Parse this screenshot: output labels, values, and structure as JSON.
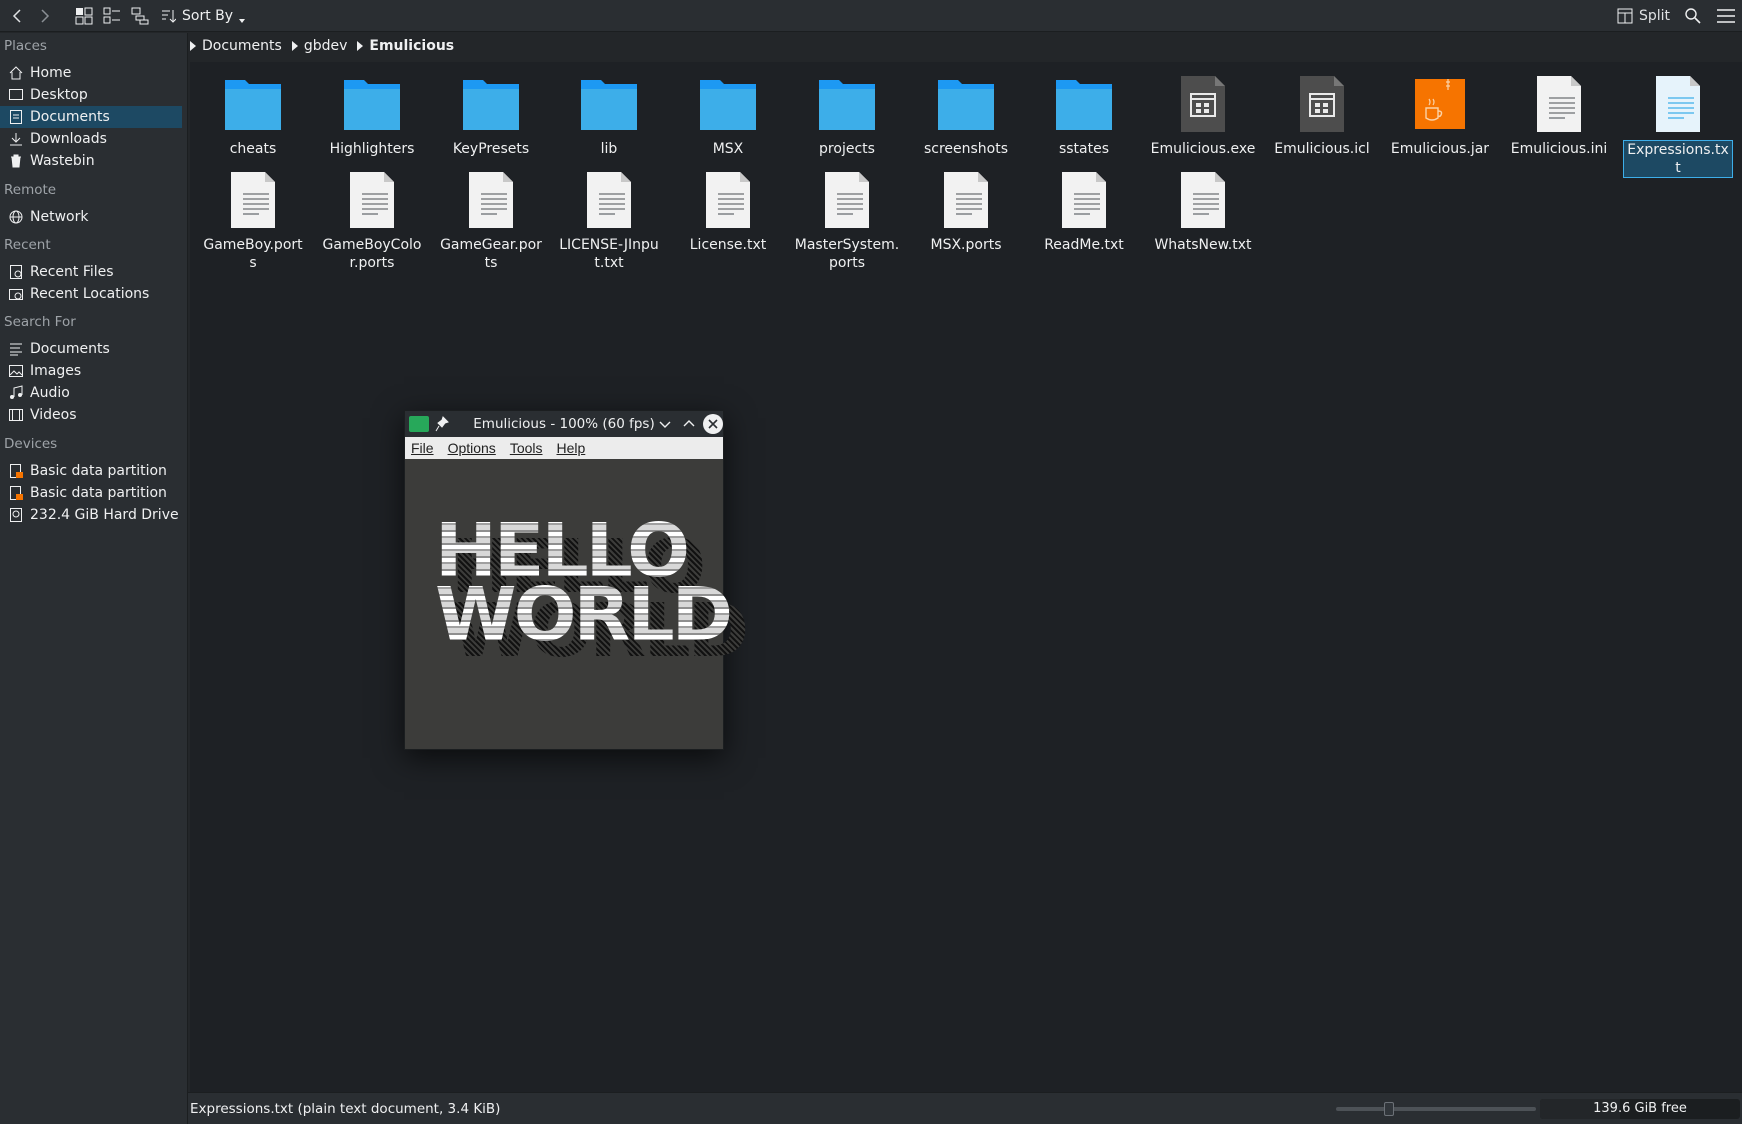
{
  "toolbar": {
    "sort_label": "Sort By",
    "split_label": "Split"
  },
  "sidebar": {
    "sections": {
      "places": "Places",
      "remote": "Remote",
      "recent": "Recent",
      "search_for": "Search For",
      "devices": "Devices"
    },
    "places": [
      {
        "label": "Home",
        "icon": "home-icon"
      },
      {
        "label": "Desktop",
        "icon": "desktop-icon"
      },
      {
        "label": "Documents",
        "icon": "documents-icon",
        "active": true
      },
      {
        "label": "Downloads",
        "icon": "downloads-icon"
      },
      {
        "label": "Wastebin",
        "icon": "trash-icon"
      }
    ],
    "remote": [
      {
        "label": "Network",
        "icon": "network-icon"
      }
    ],
    "recent": [
      {
        "label": "Recent Files",
        "icon": "recent-files-icon"
      },
      {
        "label": "Recent Locations",
        "icon": "recent-locations-icon"
      }
    ],
    "search_for": [
      {
        "label": "Documents",
        "icon": "documents-search-icon"
      },
      {
        "label": "Images",
        "icon": "images-icon"
      },
      {
        "label": "Audio",
        "icon": "audio-icon"
      },
      {
        "label": "Videos",
        "icon": "videos-icon"
      }
    ],
    "devices": [
      {
        "label": "Basic data partition",
        "icon": "partition-icon"
      },
      {
        "label": "Basic data partition",
        "icon": "partition-icon"
      },
      {
        "label": "232.4 GiB Hard Drive",
        "icon": "hard-drive-icon"
      }
    ]
  },
  "breadcrumb": [
    "Documents",
    "gbdev",
    "Emulicious"
  ],
  "files": [
    {
      "name": "cheats",
      "type": "folder"
    },
    {
      "name": "Highlighters",
      "type": "folder"
    },
    {
      "name": "KeyPresets",
      "type": "folder"
    },
    {
      "name": "lib",
      "type": "folder"
    },
    {
      "name": "MSX",
      "type": "folder"
    },
    {
      "name": "projects",
      "type": "folder"
    },
    {
      "name": "screenshots",
      "type": "folder"
    },
    {
      "name": "sstates",
      "type": "folder"
    },
    {
      "name": "Emulicious.exe",
      "type": "exe"
    },
    {
      "name": "Emulicious.icl",
      "type": "exe"
    },
    {
      "name": "Emulicious.jar",
      "type": "jar"
    },
    {
      "name": "Emulicious.ini",
      "type": "text"
    },
    {
      "name": "Expressions.txt",
      "type": "text",
      "selected": true
    },
    {
      "name": "GameBoy.ports",
      "type": "text"
    },
    {
      "name": "GameBoyColor.ports",
      "type": "text"
    },
    {
      "name": "GameGear.ports",
      "type": "text"
    },
    {
      "name": "LICENSE-JInput.txt",
      "type": "text"
    },
    {
      "name": "License.txt",
      "type": "text"
    },
    {
      "name": "MasterSystem.ports",
      "type": "text"
    },
    {
      "name": "MSX.ports",
      "type": "text"
    },
    {
      "name": "ReadMe.txt",
      "type": "text"
    },
    {
      "name": "WhatsNew.txt",
      "type": "text"
    }
  ],
  "emulator": {
    "title": "Emulicious - 100% (60 fps)",
    "menu": [
      "File",
      "Options",
      "Tools",
      "Help"
    ],
    "screen_line1": "HELLO",
    "screen_line2": "WORLD"
  },
  "status": {
    "text": "Expressions.txt (plain text document, 3.4 KiB)",
    "free_space": "139.6 GiB free",
    "zoom_level": 0.25,
    "used_fraction": 0.4
  },
  "colors": {
    "folder": "#3daee9",
    "folder_dark": "#1d99f3",
    "selection": "#1d4963",
    "accent": "#3daee9",
    "jar": "#f67400"
  }
}
